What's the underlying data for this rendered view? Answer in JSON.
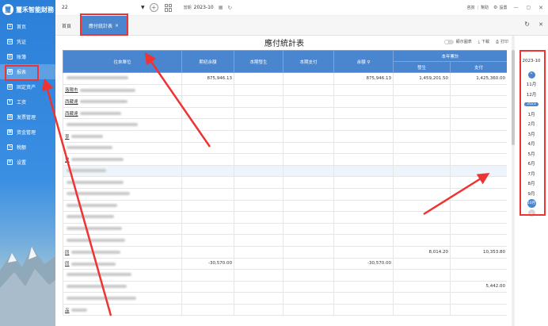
{
  "app": {
    "name": "璽禾智能財務",
    "logo_glyph": "璽"
  },
  "sidebar": {
    "items": [
      {
        "label": "首页",
        "icon": "home-icon",
        "glyph": "⌂"
      },
      {
        "label": "凭证",
        "icon": "voucher-icon",
        "glyph": "▤"
      },
      {
        "label": "账簿",
        "icon": "ledger-icon",
        "glyph": "▥"
      },
      {
        "label": "报表",
        "icon": "report-icon",
        "glyph": "▦"
      },
      {
        "label": "固定资产",
        "icon": "asset-icon",
        "glyph": "▧"
      },
      {
        "label": "工资",
        "icon": "salary-icon",
        "glyph": "¥"
      },
      {
        "label": "发票管理",
        "icon": "invoice-icon",
        "glyph": "▨"
      },
      {
        "label": "资金管理",
        "icon": "fund-icon",
        "glyph": "▩"
      },
      {
        "label": "税额",
        "icon": "tax-icon",
        "glyph": "%"
      },
      {
        "label": "设置",
        "icon": "settings-icon",
        "glyph": "⚙"
      }
    ],
    "active_index": 3
  },
  "topbar": {
    "company": "22",
    "period_label": "當期",
    "period_value": "2023-10",
    "links": [
      "咨詢",
      "幫助"
    ],
    "settings_label": "設置"
  },
  "tabs": {
    "home": "首頁",
    "active": "應付統計表",
    "close_glyph": "×"
  },
  "report": {
    "title": "應付統計表",
    "toggle_label": "顯示圖表",
    "download_label": "下載",
    "print_label": "打印",
    "headers": {
      "unit": "往來單位",
      "opening": "期初余額",
      "current_occur": "本期發生",
      "current_paid": "本期支付",
      "balance": "余額",
      "ytd": "本年累計",
      "ytd_occur": "發生",
      "ytd_paid": "支付"
    },
    "rows": [
      {
        "unit": "",
        "opening": "875,946.13",
        "occur": "",
        "paid": "",
        "balance": "875,946.13",
        "ytd_occur": "1,459,201.50",
        "ytd_paid": "1,425,360.00"
      },
      {
        "unit": "洛陽市",
        "opening": "",
        "occur": "",
        "paid": "",
        "balance": "",
        "ytd_occur": "",
        "ytd_paid": ""
      },
      {
        "unit": "西藏達",
        "opening": "",
        "occur": "",
        "paid": "",
        "balance": "",
        "ytd_occur": "",
        "ytd_paid": ""
      },
      {
        "unit": "西藏達",
        "opening": "",
        "occur": "",
        "paid": "",
        "balance": "",
        "ytd_occur": "",
        "ytd_paid": ""
      },
      {
        "unit": "",
        "opening": "",
        "occur": "",
        "paid": "",
        "balance": "",
        "ytd_occur": "",
        "ytd_paid": ""
      },
      {
        "unit": "寧",
        "opening": "",
        "occur": "",
        "paid": "",
        "balance": "",
        "ytd_occur": "",
        "ytd_paid": ""
      },
      {
        "unit": "",
        "opening": "",
        "occur": "",
        "paid": "",
        "balance": "",
        "ytd_occur": "",
        "ytd_paid": ""
      },
      {
        "unit": "重",
        "opening": "",
        "occur": "",
        "paid": "",
        "balance": "",
        "ytd_occur": "",
        "ytd_paid": ""
      },
      {
        "unit": "",
        "opening": "",
        "occur": "",
        "paid": "",
        "balance": "",
        "ytd_occur": "",
        "ytd_paid": ""
      },
      {
        "unit": "",
        "opening": "",
        "occur": "",
        "paid": "",
        "balance": "",
        "ytd_occur": "",
        "ytd_paid": ""
      },
      {
        "unit": "",
        "opening": "",
        "occur": "",
        "paid": "",
        "balance": "",
        "ytd_occur": "",
        "ytd_paid": ""
      },
      {
        "unit": "",
        "opening": "",
        "occur": "",
        "paid": "",
        "balance": "",
        "ytd_occur": "",
        "ytd_paid": ""
      },
      {
        "unit": "",
        "opening": "",
        "occur": "",
        "paid": "",
        "balance": "",
        "ytd_occur": "",
        "ytd_paid": ""
      },
      {
        "unit": "",
        "opening": "",
        "occur": "",
        "paid": "",
        "balance": "",
        "ytd_occur": "",
        "ytd_paid": ""
      },
      {
        "unit": "",
        "opening": "",
        "occur": "",
        "paid": "",
        "balance": "",
        "ytd_occur": "",
        "ytd_paid": ""
      },
      {
        "unit": "同",
        "opening": "",
        "occur": "",
        "paid": "",
        "balance": "",
        "ytd_occur": "8,014.20",
        "ytd_paid": "10,353.80"
      },
      {
        "unit": "同",
        "opening": "-30,570.00",
        "occur": "",
        "paid": "",
        "balance": "-30,570.00",
        "ytd_occur": "",
        "ytd_paid": ""
      },
      {
        "unit": "",
        "opening": "",
        "occur": "",
        "paid": "",
        "balance": "",
        "ytd_occur": "",
        "ytd_paid": ""
      },
      {
        "unit": "",
        "opening": "",
        "occur": "",
        "paid": "",
        "balance": "",
        "ytd_occur": "",
        "ytd_paid": "5,442.00"
      },
      {
        "unit": "",
        "opening": "",
        "occur": "",
        "paid": "",
        "balance": "",
        "ytd_occur": "",
        "ytd_paid": ""
      },
      {
        "unit": "品",
        "opening": "",
        "occur": "",
        "paid": "",
        "balance": "",
        "ytd_occur": "",
        "ytd_paid": ""
      }
    ]
  },
  "period_picker": {
    "current": "2023-10",
    "up_glyph": "⌃",
    "down_glyph": "⌄",
    "months": [
      "11月",
      "12月",
      "2023",
      "1月",
      "2月",
      "3月",
      "4月",
      "5月",
      "6月",
      "7月",
      "8月",
      "9月",
      "10月"
    ],
    "selected": "10月"
  },
  "window": {
    "minimize": "—",
    "maximize": "▢",
    "close": "✕",
    "refresh": "↻",
    "close_tab": "✕"
  }
}
